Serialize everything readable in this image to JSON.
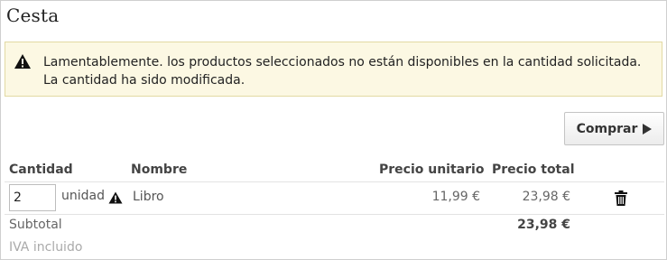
{
  "cart": {
    "title": "Cesta",
    "alert": {
      "line1": "Lamentablemente. los productos seleccionados no están disponibles en la cantidad solicitada.",
      "line2": "La cantidad ha sido modificada.",
      "icon": "warning-icon"
    },
    "buy_button": {
      "label": "Comprar",
      "icon": "play-arrow-icon"
    },
    "table": {
      "headers": {
        "quantity": "Cantidad",
        "name": "Nombre",
        "unit_price": "Precio unitario",
        "total_price": "Precio total"
      },
      "rows": [
        {
          "quantity": "2",
          "unit": "unidad",
          "warning_icon": "warning-icon",
          "name": "Libro",
          "unit_price": "11,99 €",
          "total_price": "23,98 €",
          "delete_icon": "trash-icon"
        }
      ]
    },
    "subtotal": {
      "label": "Subtotal",
      "value": "23,98 €"
    },
    "vat_note": "IVA incluido"
  },
  "colors": {
    "alert_bg": "#fcf8e3",
    "alert_border": "#e2d9a3",
    "border": "#cfcfcf"
  }
}
